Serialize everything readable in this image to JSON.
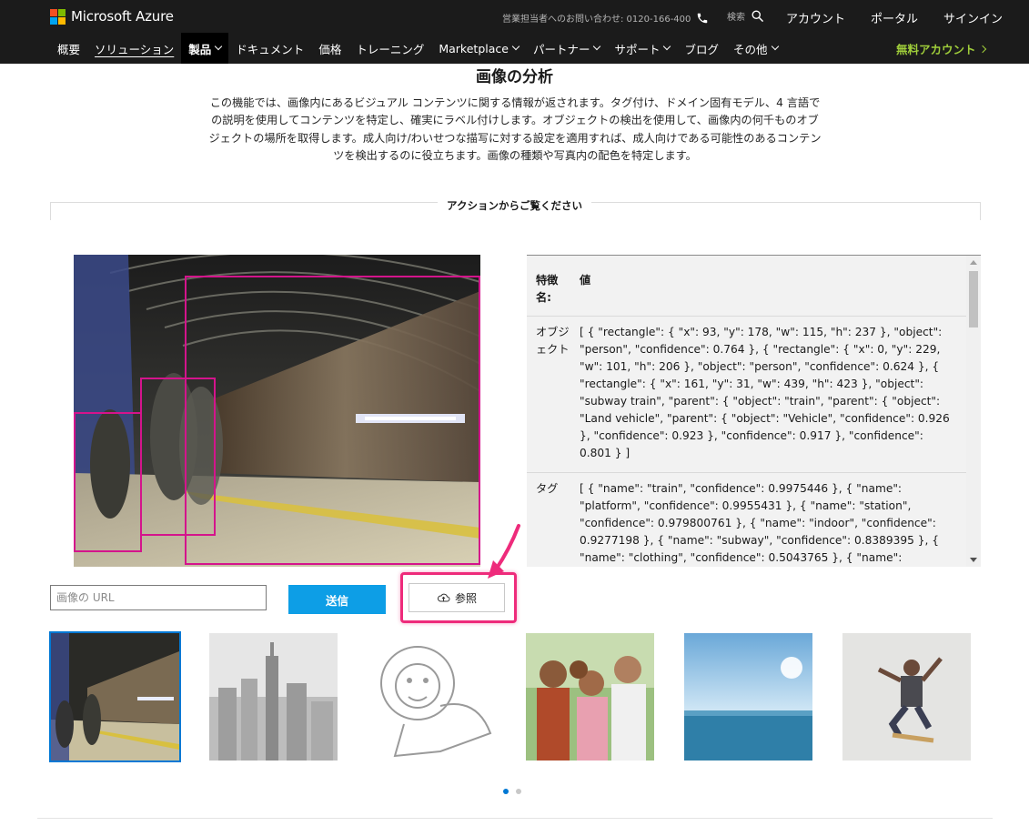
{
  "header": {
    "brand": "Microsoft Azure",
    "contact": "営業担当者へのお問い合わせ: 0120-166-400",
    "search_label": "検索",
    "links": [
      "アカウント",
      "ポータル",
      "サインイン"
    ]
  },
  "nav": {
    "items": [
      "概要",
      "ソリューション",
      "製品",
      "ドキュメント",
      "価格",
      "トレーニング",
      "Marketplace",
      "パートナー",
      "サポート",
      "ブログ",
      "その他"
    ],
    "free_account": "無料アカウント"
  },
  "section": {
    "title": "画像の分析",
    "description": "この機能では、画像内にあるビジュアル コンテンツに関する情報が返されます。タグ付け、ドメイン固有モデル、4 言語での説明を使用してコンテンツを特定し、確実にラベル付けします。オブジェクトの検出を使用して、画像内の何千ものオブジェクトの場所を取得します。成人向け/わいせつな描写に対する設定を適用すれば、成人向けである可能性のあるコンテンツを検出するのに役立ちます。画像の種類や写真内の配色を特定します。",
    "action_label": "アクションからご覧ください"
  },
  "results": {
    "header_key": "特徴名:",
    "header_value": "値",
    "objects_key": "オブジェクト",
    "objects_value": "[ { \"rectangle\": { \"x\": 93, \"y\": 178, \"w\": 115, \"h\": 237 }, \"object\": \"person\", \"confidence\": 0.764 }, { \"rectangle\": { \"x\": 0, \"y\": 229, \"w\": 101, \"h\": 206 }, \"object\": \"person\", \"confidence\": 0.624 }, { \"rectangle\": { \"x\": 161, \"y\": 31, \"w\": 439, \"h\": 423 }, \"object\": \"subway train\", \"parent\": { \"object\": \"train\", \"parent\": { \"object\": \"Land vehicle\", \"parent\": { \"object\": \"Vehicle\", \"confidence\": 0.926 }, \"confidence\": 0.923 }, \"confidence\": 0.917 }, \"confidence\": 0.801 } ]",
    "tags_key": "タグ",
    "tags_value": "[ { \"name\": \"train\", \"confidence\": 0.9975446 }, { \"name\": \"platform\", \"confidence\": 0.9955431 }, { \"name\": \"station\", \"confidence\": 0.979800761 }, { \"name\": \"indoor\", \"confidence\": 0.9277198 }, { \"name\": \"subway\", \"confidence\": 0.8389395 }, { \"name\": \"clothing\", \"confidence\": 0.5043765 }, { \"name\":"
  },
  "controls": {
    "url_placeholder": "画像の URL",
    "submit_label": "送信",
    "browse_label": "参照"
  },
  "colors": {
    "header_bg": "#1b1b1b",
    "accent_green": "#9fcd3a",
    "submit_blue": "#0d9ee6",
    "bbox_magenta": "#d4148c",
    "highlight_pink": "#ee2b7b",
    "selected_outline": "#0078d4"
  },
  "icons": {
    "phone": "phone-icon",
    "search": "search-icon",
    "browse": "cloud-upload-icon"
  }
}
